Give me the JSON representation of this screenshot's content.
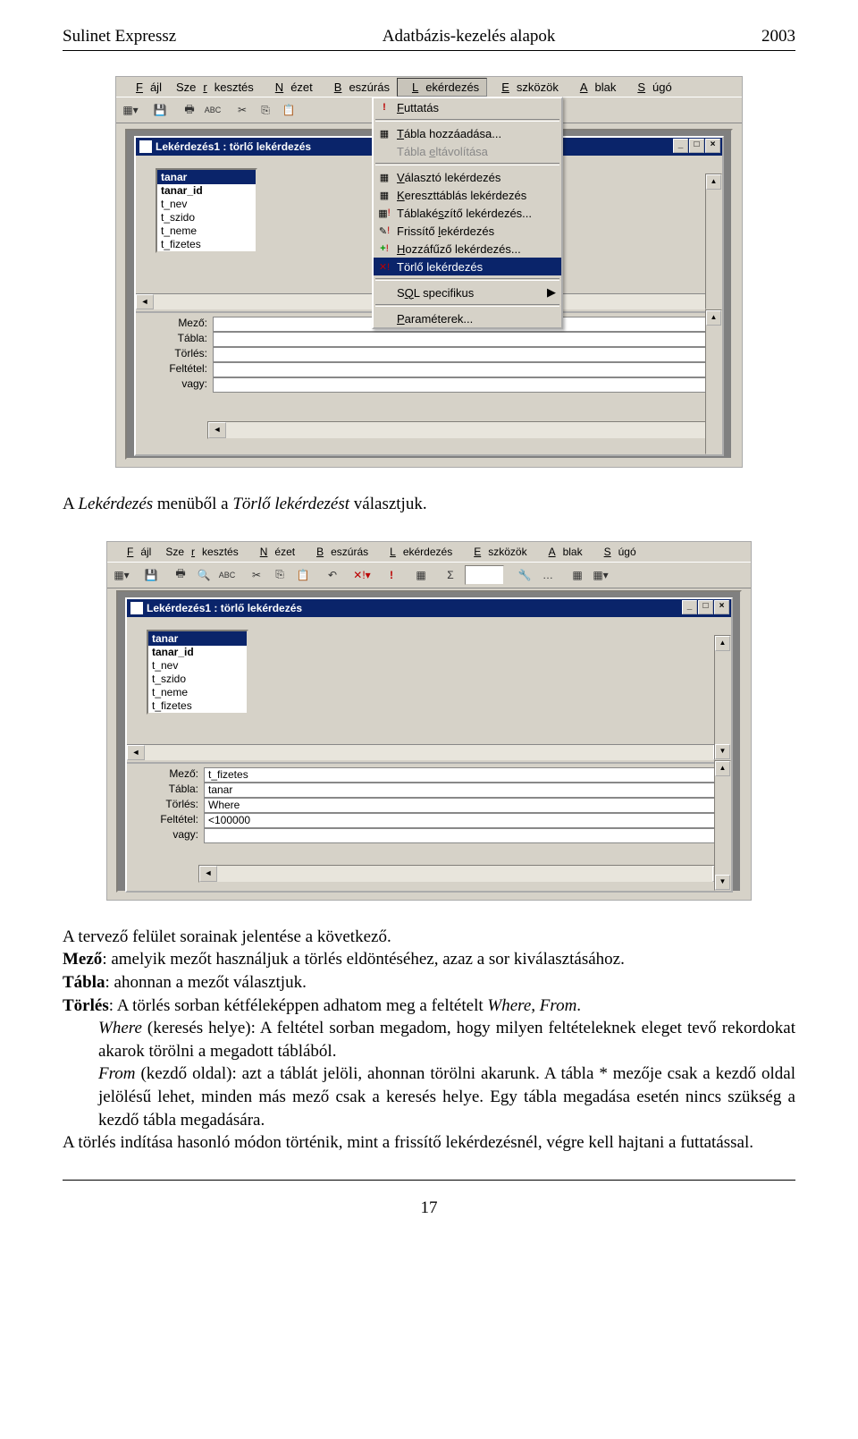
{
  "header": {
    "left": "Sulinet Expressz",
    "center": "Adatbázis-kezelés alapok",
    "right": "2003"
  },
  "menubar": [
    "Fájl",
    "Szerkesztés",
    "Nézet",
    "Beszúrás",
    "Lekérdezés",
    "Eszközök",
    "Ablak",
    "Súgó"
  ],
  "menubar_underline": [
    "F",
    "r",
    "N",
    "B",
    "L",
    "E",
    "A",
    "S"
  ],
  "window_title": "Lekérdezés1 : törlő lekérdezés",
  "table": {
    "name": "tanar",
    "fields": [
      "tanar_id",
      "t_nev",
      "t_szido",
      "t_neme",
      "t_fizetes"
    ]
  },
  "grid_labels": [
    "Mező:",
    "Tábla:",
    "Törlés:",
    "Feltétel:",
    "vagy:"
  ],
  "dropdown": [
    {
      "label": "Futtatás",
      "icon": "!",
      "key": "F"
    },
    {
      "sep": true
    },
    {
      "label": "Tábla hozzáadása...",
      "icon": "▦",
      "key": "T"
    },
    {
      "label": "Tábla eltávolítása",
      "key": "e",
      "disabled": true
    },
    {
      "sep": true
    },
    {
      "label": "Választó lekérdezés",
      "icon": "▦",
      "key": "V"
    },
    {
      "label": "Kereszttáblás lekérdezés",
      "icon": "▦",
      "key": "K"
    },
    {
      "label": "Táblakészítő lekérdezés...",
      "icon": "▦!",
      "key": "s"
    },
    {
      "label": "Frissítő lekérdezés",
      "icon": "🔧!",
      "key": "l"
    },
    {
      "label": "Hozzáfűző lekérdezés...",
      "icon": "+!",
      "key": "H"
    },
    {
      "label": "Törlő lekérdezés",
      "icon": "✕!",
      "hi": true
    },
    {
      "sep": true
    },
    {
      "label": "SQL specifikus",
      "key": "Q",
      "arrow": "▶"
    },
    {
      "sep": true
    },
    {
      "label": "Paraméterek...",
      "key": "P"
    }
  ],
  "grid2": {
    "mezo": "t_fizetes",
    "tabla": "tanar",
    "torles": "Where",
    "feltetel": "<100000",
    "vagy": ""
  },
  "text": {
    "p1_a": "A ",
    "p1_i": "Lekérdezés",
    "p1_b": " menüből a ",
    "p1_i2": "Törlő lekérdezést",
    "p1_c": " választjuk.",
    "p2": "A tervező felület sorainak jelentése a következő.",
    "p3_b1": "Mező",
    "p3_t1": ": amelyik mezőt használjuk a törlés eldöntéséhez, azaz a sor kiválasztásához.",
    "p4_b1": "Tábla",
    "p4_t1": ": ahonnan a mezőt választjuk.",
    "p5_b1": "Törlés",
    "p5_t1": ": A törlés sorban kétféleképpen adhatom meg a feltételt ",
    "p5_i1": "Where, From",
    "p5_t2": ".",
    "p6_i1": "Where",
    "p6_t1": " (keresés helye): A feltétel sorban megadom, hogy milyen feltételeknek eleget tevő rekordokat akarok törölni a megadott táblából.",
    "p7_i1": "From",
    "p7_t1": " (kezdő oldal): azt a táblát jelöli, ahonnan törölni akarunk. A tábla * mezője csak a kezdő oldal jelölésű lehet, minden más mező csak a keresés helye. Egy tábla megadása esetén nincs szükség a kezdő tábla megadására.",
    "p8": "A törlés indítása hasonló módon történik, mint a frissítő lekérdezésnél, végre kell hajtani a futtatással."
  },
  "pagenum": "17"
}
